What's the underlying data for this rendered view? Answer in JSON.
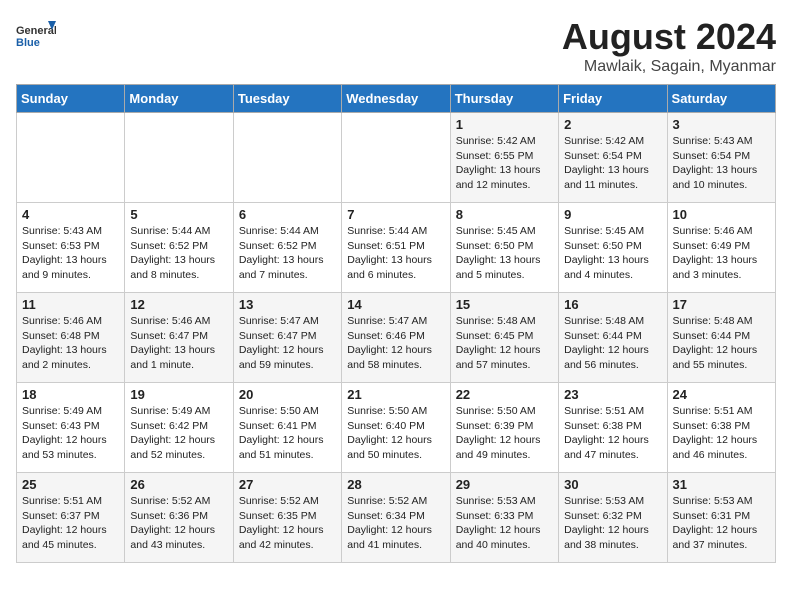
{
  "header": {
    "logo_general": "General",
    "logo_blue": "Blue",
    "title": "August 2024",
    "subtitle": "Mawlaik, Sagain, Myanmar"
  },
  "days_of_week": [
    "Sunday",
    "Monday",
    "Tuesday",
    "Wednesday",
    "Thursday",
    "Friday",
    "Saturday"
  ],
  "weeks": [
    [
      {
        "day": "",
        "content": ""
      },
      {
        "day": "",
        "content": ""
      },
      {
        "day": "",
        "content": ""
      },
      {
        "day": "",
        "content": ""
      },
      {
        "day": "1",
        "content": "Sunrise: 5:42 AM\nSunset: 6:55 PM\nDaylight: 13 hours\nand 12 minutes."
      },
      {
        "day": "2",
        "content": "Sunrise: 5:42 AM\nSunset: 6:54 PM\nDaylight: 13 hours\nand 11 minutes."
      },
      {
        "day": "3",
        "content": "Sunrise: 5:43 AM\nSunset: 6:54 PM\nDaylight: 13 hours\nand 10 minutes."
      }
    ],
    [
      {
        "day": "4",
        "content": "Sunrise: 5:43 AM\nSunset: 6:53 PM\nDaylight: 13 hours\nand 9 minutes."
      },
      {
        "day": "5",
        "content": "Sunrise: 5:44 AM\nSunset: 6:52 PM\nDaylight: 13 hours\nand 8 minutes."
      },
      {
        "day": "6",
        "content": "Sunrise: 5:44 AM\nSunset: 6:52 PM\nDaylight: 13 hours\nand 7 minutes."
      },
      {
        "day": "7",
        "content": "Sunrise: 5:44 AM\nSunset: 6:51 PM\nDaylight: 13 hours\nand 6 minutes."
      },
      {
        "day": "8",
        "content": "Sunrise: 5:45 AM\nSunset: 6:50 PM\nDaylight: 13 hours\nand 5 minutes."
      },
      {
        "day": "9",
        "content": "Sunrise: 5:45 AM\nSunset: 6:50 PM\nDaylight: 13 hours\nand 4 minutes."
      },
      {
        "day": "10",
        "content": "Sunrise: 5:46 AM\nSunset: 6:49 PM\nDaylight: 13 hours\nand 3 minutes."
      }
    ],
    [
      {
        "day": "11",
        "content": "Sunrise: 5:46 AM\nSunset: 6:48 PM\nDaylight: 13 hours\nand 2 minutes."
      },
      {
        "day": "12",
        "content": "Sunrise: 5:46 AM\nSunset: 6:47 PM\nDaylight: 13 hours\nand 1 minute."
      },
      {
        "day": "13",
        "content": "Sunrise: 5:47 AM\nSunset: 6:47 PM\nDaylight: 12 hours\nand 59 minutes."
      },
      {
        "day": "14",
        "content": "Sunrise: 5:47 AM\nSunset: 6:46 PM\nDaylight: 12 hours\nand 58 minutes."
      },
      {
        "day": "15",
        "content": "Sunrise: 5:48 AM\nSunset: 6:45 PM\nDaylight: 12 hours\nand 57 minutes."
      },
      {
        "day": "16",
        "content": "Sunrise: 5:48 AM\nSunset: 6:44 PM\nDaylight: 12 hours\nand 56 minutes."
      },
      {
        "day": "17",
        "content": "Sunrise: 5:48 AM\nSunset: 6:44 PM\nDaylight: 12 hours\nand 55 minutes."
      }
    ],
    [
      {
        "day": "18",
        "content": "Sunrise: 5:49 AM\nSunset: 6:43 PM\nDaylight: 12 hours\nand 53 minutes."
      },
      {
        "day": "19",
        "content": "Sunrise: 5:49 AM\nSunset: 6:42 PM\nDaylight: 12 hours\nand 52 minutes."
      },
      {
        "day": "20",
        "content": "Sunrise: 5:50 AM\nSunset: 6:41 PM\nDaylight: 12 hours\nand 51 minutes."
      },
      {
        "day": "21",
        "content": "Sunrise: 5:50 AM\nSunset: 6:40 PM\nDaylight: 12 hours\nand 50 minutes."
      },
      {
        "day": "22",
        "content": "Sunrise: 5:50 AM\nSunset: 6:39 PM\nDaylight: 12 hours\nand 49 minutes."
      },
      {
        "day": "23",
        "content": "Sunrise: 5:51 AM\nSunset: 6:38 PM\nDaylight: 12 hours\nand 47 minutes."
      },
      {
        "day": "24",
        "content": "Sunrise: 5:51 AM\nSunset: 6:38 PM\nDaylight: 12 hours\nand 46 minutes."
      }
    ],
    [
      {
        "day": "25",
        "content": "Sunrise: 5:51 AM\nSunset: 6:37 PM\nDaylight: 12 hours\nand 45 minutes."
      },
      {
        "day": "26",
        "content": "Sunrise: 5:52 AM\nSunset: 6:36 PM\nDaylight: 12 hours\nand 43 minutes."
      },
      {
        "day": "27",
        "content": "Sunrise: 5:52 AM\nSunset: 6:35 PM\nDaylight: 12 hours\nand 42 minutes."
      },
      {
        "day": "28",
        "content": "Sunrise: 5:52 AM\nSunset: 6:34 PM\nDaylight: 12 hours\nand 41 minutes."
      },
      {
        "day": "29",
        "content": "Sunrise: 5:53 AM\nSunset: 6:33 PM\nDaylight: 12 hours\nand 40 minutes."
      },
      {
        "day": "30",
        "content": "Sunrise: 5:53 AM\nSunset: 6:32 PM\nDaylight: 12 hours\nand 38 minutes."
      },
      {
        "day": "31",
        "content": "Sunrise: 5:53 AM\nSunset: 6:31 PM\nDaylight: 12 hours\nand 37 minutes."
      }
    ]
  ]
}
